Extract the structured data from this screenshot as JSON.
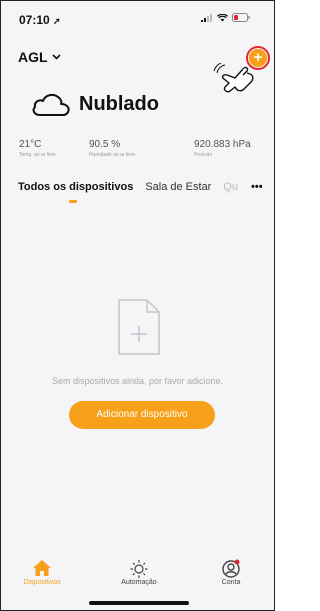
{
  "status": {
    "time": "07:10"
  },
  "header": {
    "home_name": "AGL",
    "add_symbol": "+"
  },
  "weather": {
    "condition": "Nublado"
  },
  "stats": [
    {
      "value": "21°C",
      "label": "Temp. ao ar livre"
    },
    {
      "value": "90.5 %",
      "label": "Humidade ao ar livre"
    },
    {
      "value": "920.883 hPa",
      "label": "Pressão"
    }
  ],
  "tabs": [
    {
      "label": "Todos os dispositivos"
    },
    {
      "label": "Sala de Estar"
    },
    {
      "label": "Qu"
    }
  ],
  "more_label": "•••",
  "empty": {
    "message": "Sem dispositivos ainda, por favor adicione.",
    "button_label": "Adicionar dispositivo"
  },
  "nav": [
    {
      "label": "Dispositivos",
      "icon": "home-icon",
      "active": true
    },
    {
      "label": "Automação",
      "icon": "sun-icon",
      "active": false
    },
    {
      "label": "Conta",
      "icon": "account-icon",
      "active": false
    }
  ],
  "colors": {
    "accent": "#f7a01a",
    "highlight": "#e8252b",
    "background": "#f5f5f7"
  }
}
